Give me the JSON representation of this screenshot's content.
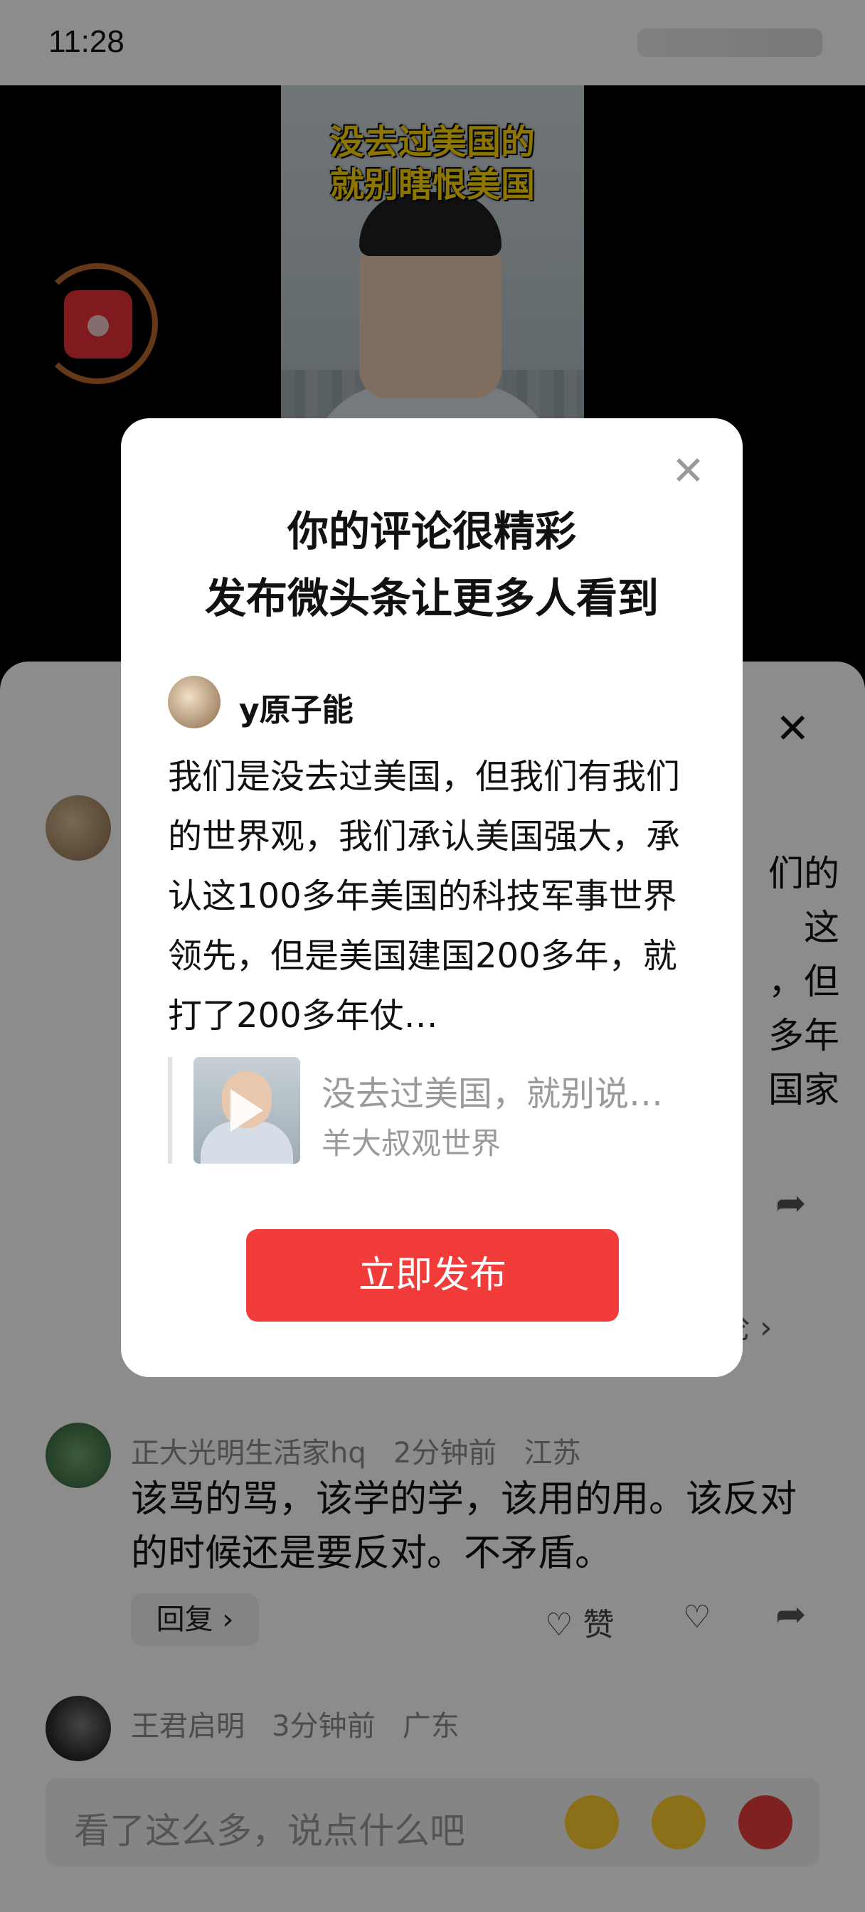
{
  "status_bar": {
    "time": "11:28"
  },
  "video": {
    "overlay_title_line1": "没去过美国的",
    "overlay_title_line2": "就别瞎恨美国"
  },
  "modal": {
    "title_line1": "你的评论很精彩",
    "title_line2": "发布微头条让更多人看到",
    "username": "y原子能",
    "comment": "我们是没去过美国，但我们有我们的世界观，我们承认美国强大，承认这100多年美国的科技军事世界领先，但是美国建国200多年，就打了200多年仗…",
    "quoted_video_title": "没去过美国，就别说…",
    "quoted_video_author": "羊大叔观世界",
    "publish_label": "立即发布"
  },
  "comments": {
    "first_partial_text": "们的\n这\n，但\n多年\n国家",
    "more_replies": "论 ›",
    "items": [
      {
        "author": "正大光明生活家hq",
        "time": "2分钟前",
        "location": "江苏",
        "text": "该骂的骂，该学的学，该用的用。该反对的时候还是要反对。不矛盾。",
        "reply_label": "回复 ›",
        "like_label": "赞"
      },
      {
        "author": "王君启明",
        "time": "3分钟前",
        "location": "广东"
      }
    ]
  },
  "input_bar": {
    "placeholder": "看了这么多，说点什么吧"
  },
  "icons": [
    "close-icon",
    "share-icon",
    "heart-icon",
    "dislike-icon",
    "play-icon",
    "red-packet-icon",
    "emoji-laugh-icon",
    "emoji-grin-icon",
    "emoji-angry-icon"
  ]
}
